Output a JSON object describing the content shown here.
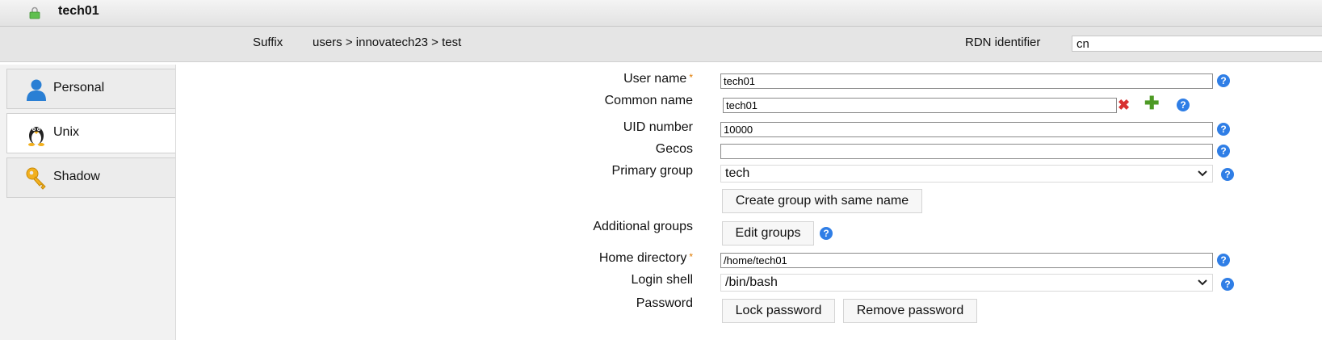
{
  "header": {
    "title": "tech01",
    "lock_icon": "lock-icon",
    "lock_color": "#4caf50"
  },
  "suffix_bar": {
    "suffix_label": "Suffix",
    "suffix_value": "users > innovatech23 > test",
    "rdn_label": "RDN identifier",
    "rdn_value": "cn"
  },
  "sidebar": {
    "tabs": [
      {
        "label": "Personal",
        "icon": "person-icon",
        "active": false
      },
      {
        "label": "Unix",
        "icon": "penguin-icon",
        "active": true
      },
      {
        "label": "Shadow",
        "icon": "key-icon",
        "active": false
      }
    ]
  },
  "form": {
    "user_name": {
      "label": "User name",
      "required_mark": "*",
      "value": "tech01"
    },
    "common_name": {
      "label": "Common name",
      "value": "tech01"
    },
    "uid_number": {
      "label": "UID number",
      "value": "10000"
    },
    "gecos": {
      "label": "Gecos",
      "value": ""
    },
    "primary_group": {
      "label": "Primary group",
      "value": "tech"
    },
    "create_group_button": "Create group with same name",
    "additional_groups": {
      "label": "Additional groups",
      "button": "Edit groups"
    },
    "home_directory": {
      "label": "Home directory",
      "required_mark": "*",
      "value": "/home/tech01"
    },
    "login_shell": {
      "label": "Login shell",
      "value": "/bin/bash"
    },
    "password": {
      "label": "Password",
      "lock_button": "Lock password",
      "remove_button": "Remove password"
    },
    "help_glyph": "?"
  },
  "colors": {
    "help": "#2f7ee6",
    "required": "#e07b00",
    "delete": "#d83030",
    "add": "#4d9a24"
  }
}
